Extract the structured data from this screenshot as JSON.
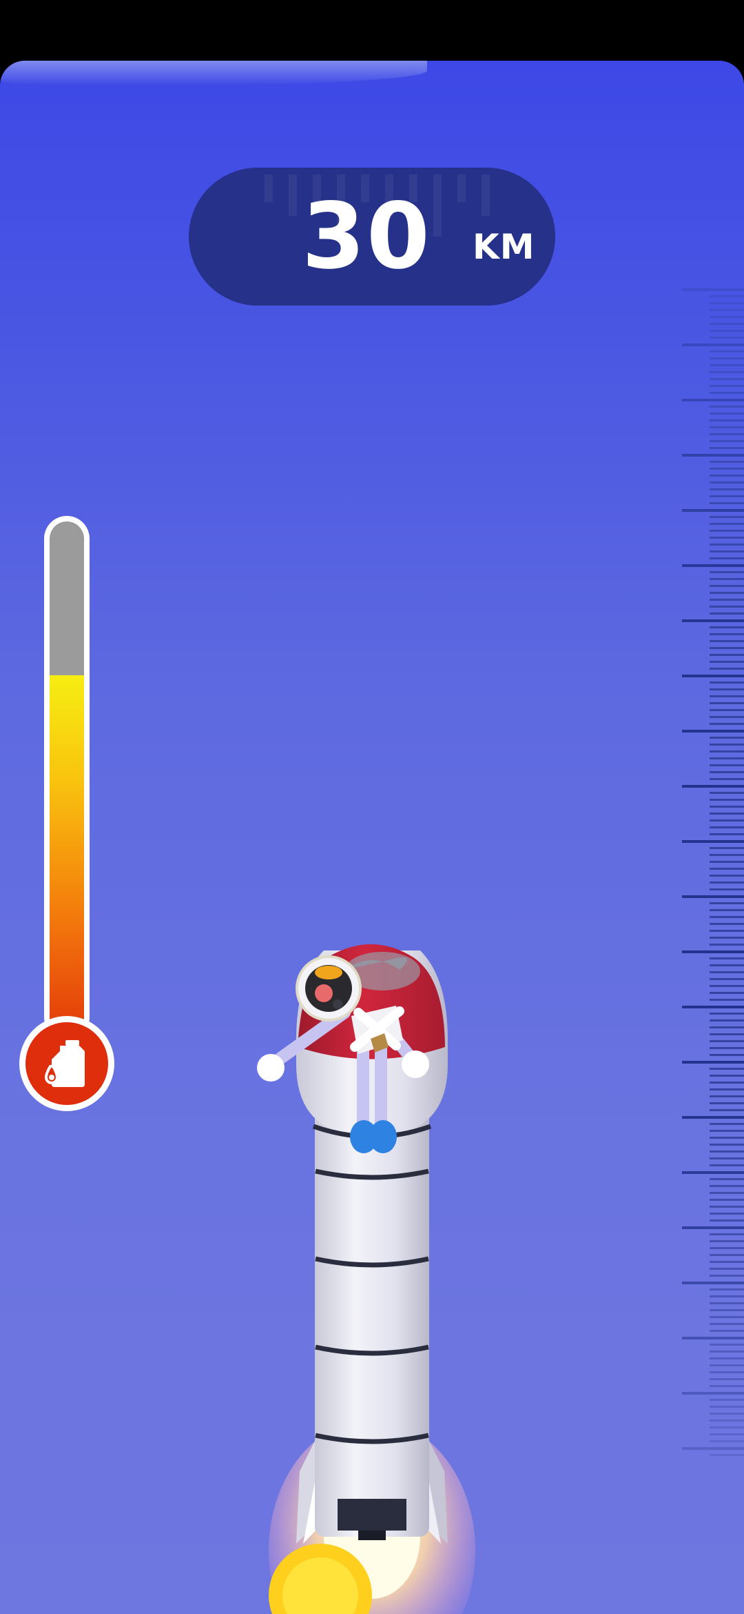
{
  "hud": {
    "altitude": {
      "value": "30",
      "unit": "KM"
    },
    "fuel": {
      "level": 0.7,
      "icon": "fuel-can-icon"
    },
    "ruler": {
      "icon": "altitude-ruler"
    }
  },
  "colors": {
    "sky_top": "#3d48e6",
    "sky_bottom": "#6e76e0",
    "pill": "#26318a",
    "fuel_button": "#df2e0c",
    "fuel_gradient_top": "#f6ee12",
    "fuel_gradient_bottom": "#e23a0a",
    "rocket_body": "#e8e8f2",
    "rocket_nose": "#c8223a"
  }
}
